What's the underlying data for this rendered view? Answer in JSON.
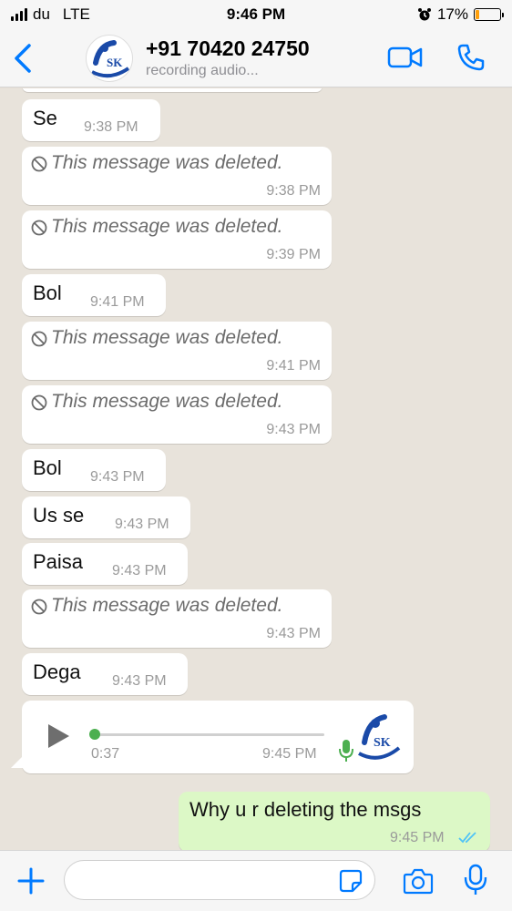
{
  "status_bar": {
    "carrier": "du",
    "network": "LTE",
    "time": "9:46 PM",
    "battery": "17%",
    "battery_level": 0.17
  },
  "header": {
    "contact_name": "+91 70420 24750",
    "contact_status": "recording audio...",
    "avatar_text": "SK"
  },
  "messages": [
    {
      "text": "Se",
      "time": "9:38 PM"
    },
    {
      "text": "This message was deleted.",
      "time": "9:38 PM"
    },
    {
      "text": "This message was deleted.",
      "time": "9:39 PM"
    },
    {
      "text": "Bol",
      "time": "9:41 PM"
    },
    {
      "text": "This message was deleted.",
      "time": "9:41 PM"
    },
    {
      "text": "This message was deleted.",
      "time": "9:43 PM"
    },
    {
      "text": "Bol",
      "time": "9:43 PM"
    },
    {
      "text": "Us se",
      "time": "9:43 PM"
    },
    {
      "text": "Paisa",
      "time": "9:43 PM"
    },
    {
      "text": "This message was deleted.",
      "time": "9:43 PM"
    },
    {
      "text": "Dega",
      "time": "9:43 PM"
    }
  ],
  "voice_note": {
    "duration": "0:37",
    "time": "9:45 PM",
    "progress": 0.0,
    "avatar_text": "SK"
  },
  "outgoing": {
    "text": "Why u r deleting the msgs",
    "time": "9:45 PM"
  },
  "colors": {
    "accent": "#007aff",
    "outgoing_bubble": "#dcf8c6",
    "incoming_bubble": "#ffffff",
    "chat_bg": "#e8e3db",
    "voice_green": "#4caf50",
    "read_ticks": "#4fc3f7"
  },
  "icons": {
    "back": "chevron-left-icon",
    "video": "video-camera-icon",
    "call": "phone-icon",
    "deleted": "ban-icon",
    "play": "play-icon",
    "mic_small": "microphone-icon",
    "ticks": "double-check-icon",
    "plus": "plus-icon",
    "sticker": "sticker-icon",
    "camera": "camera-icon",
    "mic": "microphone-icon"
  }
}
